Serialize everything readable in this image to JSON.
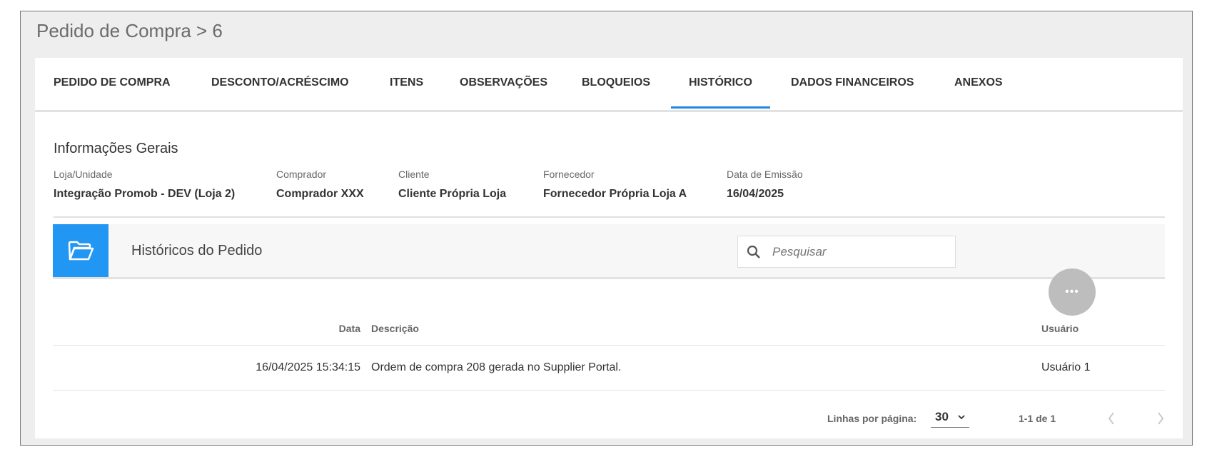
{
  "page_title": "Pedido de Compra > 6",
  "tabs": [
    "PEDIDO DE COMPRA",
    "DESCONTO/ACRÉSCIMO",
    "ITENS",
    "OBSERVAÇÕES",
    "BLOQUEIOS",
    "HISTÓRICO",
    "DADOS FINANCEIROS",
    "ANEXOS"
  ],
  "active_tab": "HISTÓRICO",
  "info": {
    "heading": "Informações Gerais",
    "fields": [
      {
        "label": "Loja/Unidade",
        "value": "Integração Promob - DEV (Loja 2)"
      },
      {
        "label": "Comprador",
        "value": "Comprador XXX"
      },
      {
        "label": "Cliente",
        "value": "Cliente Própria Loja"
      },
      {
        "label": "Fornecedor",
        "value": "Fornecedor Própria Loja A"
      },
      {
        "label": "Data de Emissão",
        "value": "16/04/2025"
      }
    ]
  },
  "history": {
    "title": "Históricos do Pedido",
    "search_placeholder": "Pesquisar",
    "more_label": "•••",
    "columns": {
      "date": "Data",
      "description": "Descrição",
      "user": "Usuário"
    },
    "rows": [
      {
        "date": "16/04/2025 15:34:15",
        "description": "Ordem de compra 208 gerada no Supplier Portal.",
        "user": "Usuário 1"
      }
    ],
    "pagination": {
      "rows_per_page_label": "Linhas por página:",
      "rows_per_page": "30",
      "range": "1-1 de 1"
    }
  },
  "colors": {
    "accent": "#1e88e5",
    "folder_bg": "#2196f3"
  }
}
